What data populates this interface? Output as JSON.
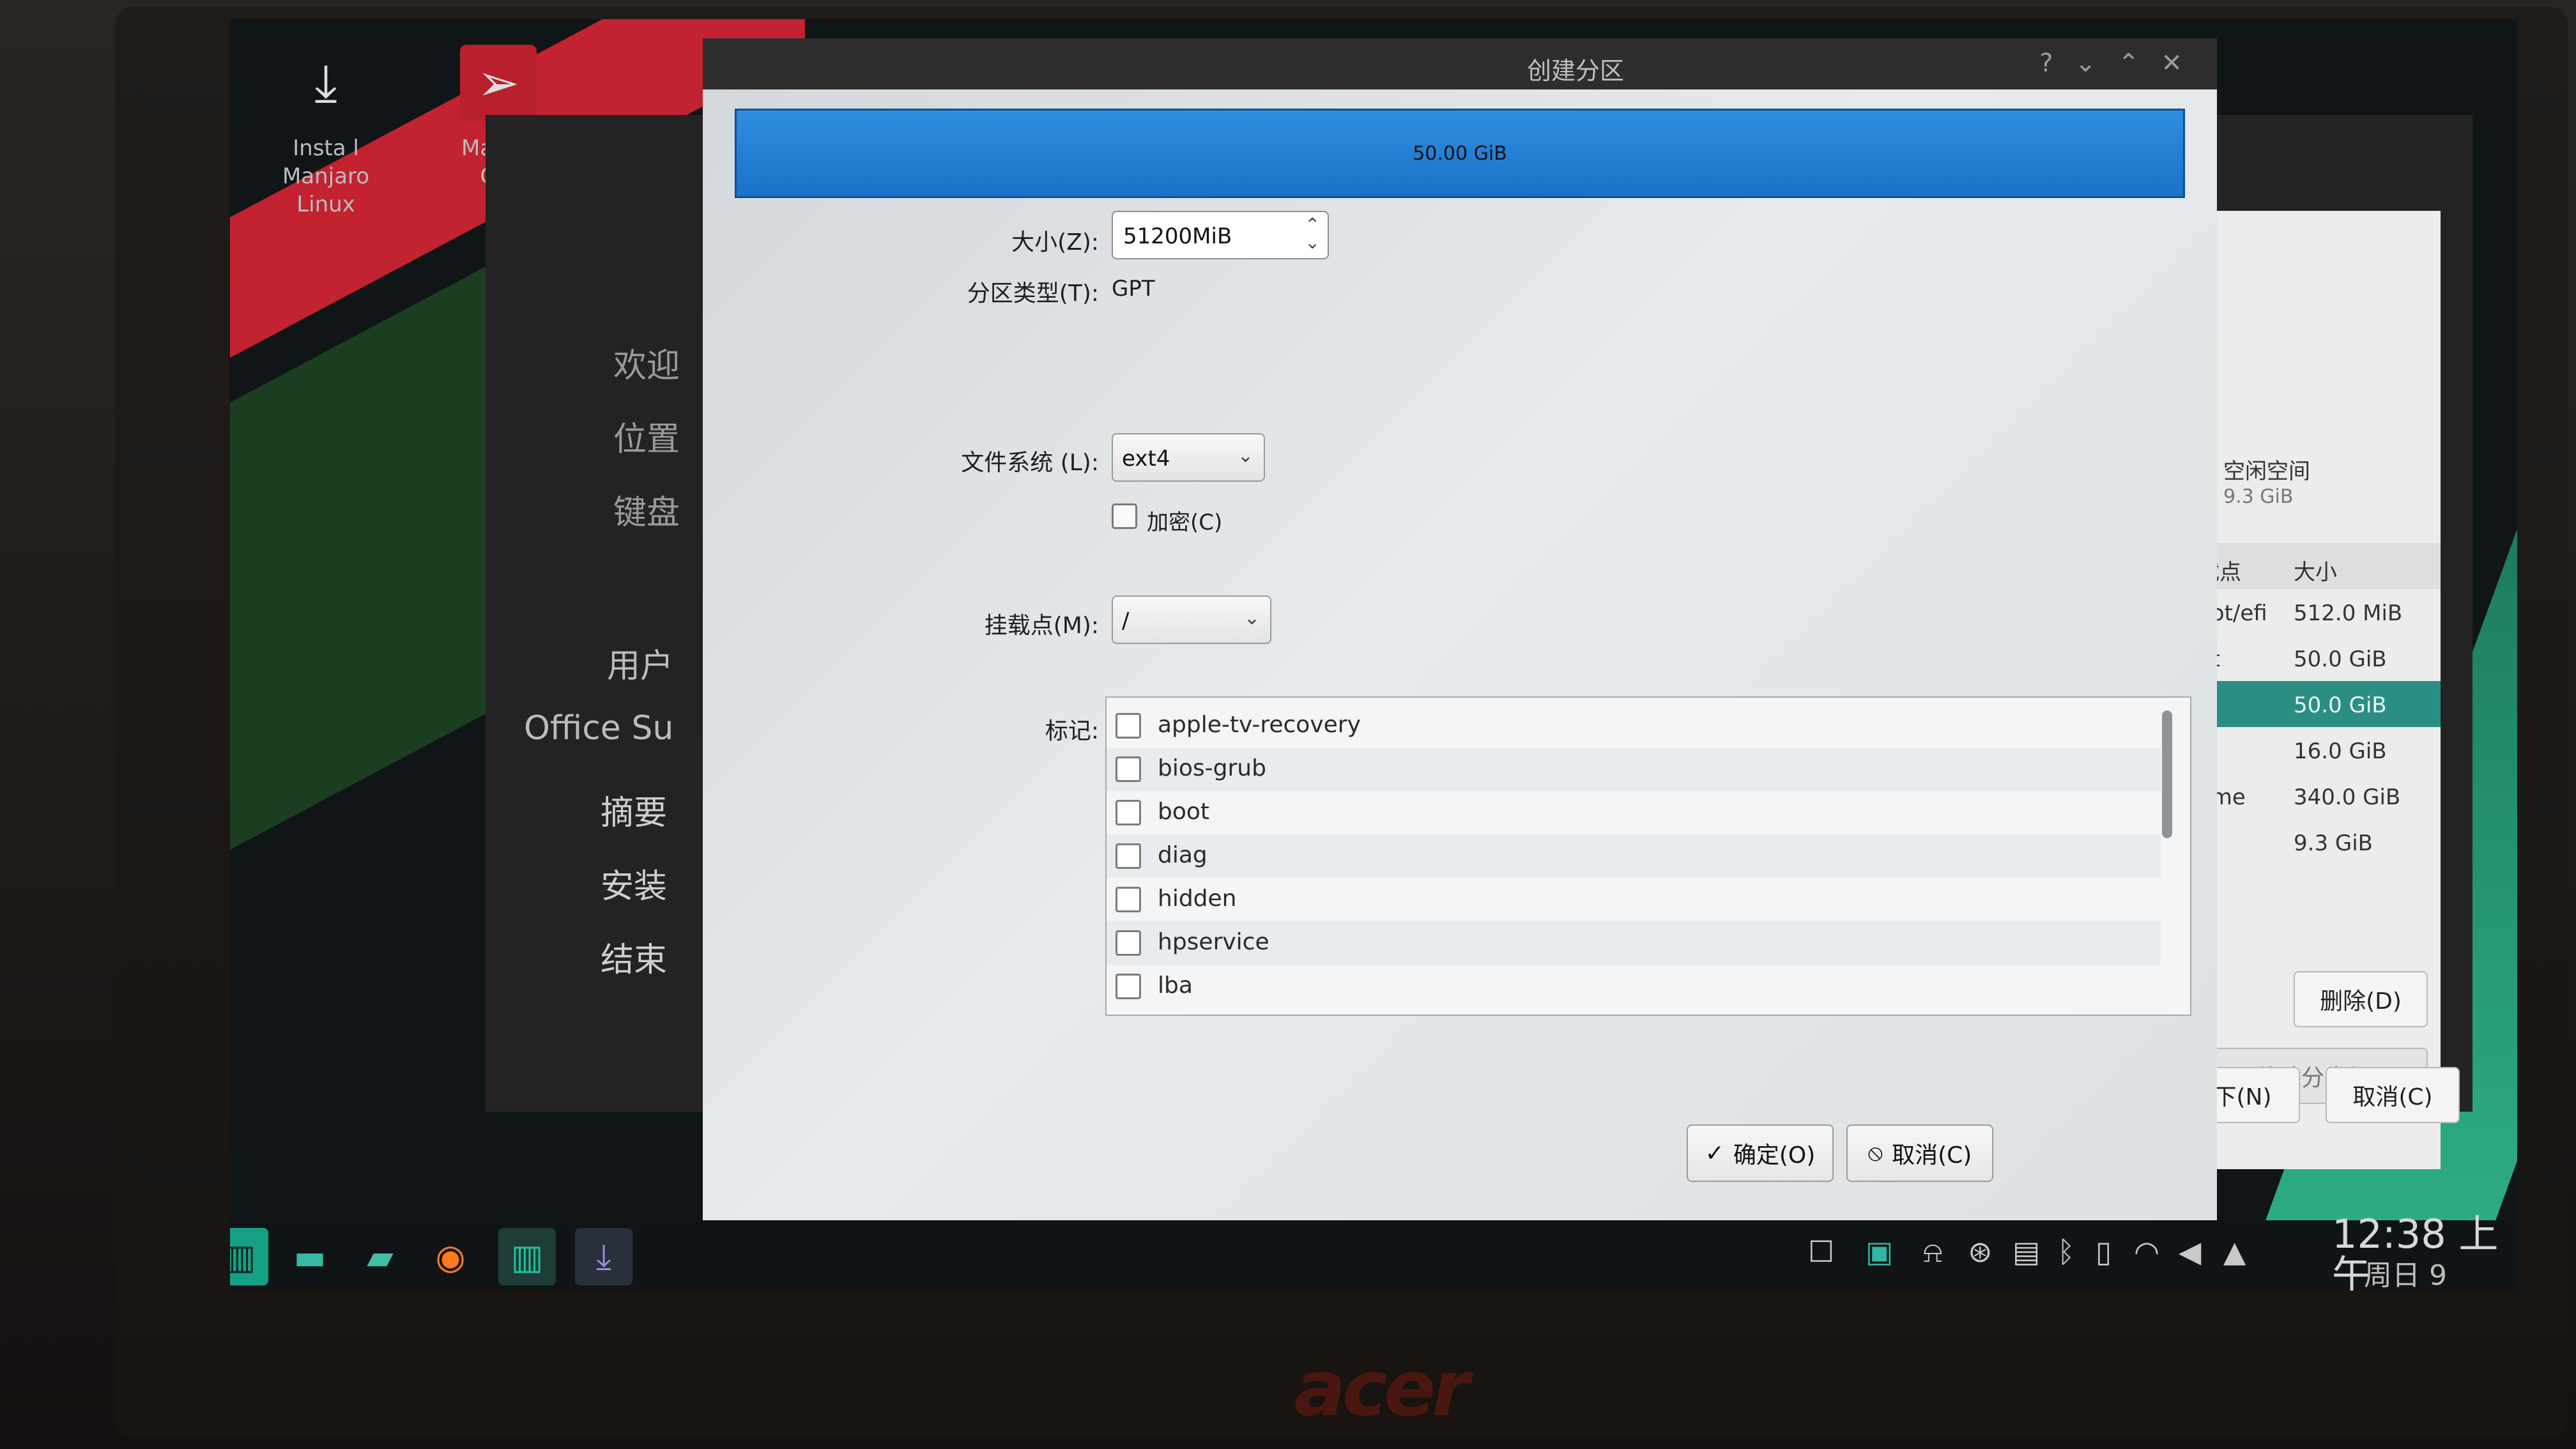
{
  "desktop": {
    "icons": [
      {
        "label_line1": "Insta l Manjaro",
        "label_line2": "Linux"
      },
      {
        "label_line1": "Manjar",
        "label_line2": "Gui"
      }
    ]
  },
  "installer": {
    "sidebar": [
      "欢迎",
      "位置",
      "键盘",
      "用户",
      "Office Su",
      "摘要",
      "安装",
      "结束"
    ],
    "right_panel": {
      "free_space_label": "空闲空间",
      "free_space_size": "9.3 GiB",
      "col_mount": "载点",
      "col_size": "大小",
      "rows": [
        {
          "mount": "oot/efi",
          "size": "512.0 MiB"
        },
        {
          "mount": "pt",
          "size": "50.0 GiB"
        },
        {
          "mount": "",
          "size": "50.0 GiB"
        },
        {
          "mount": "",
          "size": "16.0 GiB"
        },
        {
          "mount": "ome",
          "size": "340.0 GiB"
        },
        {
          "mount": "",
          "size": "9.3 GiB"
        }
      ],
      "delete_button": "删除(D)",
      "remove_vg_button": "移除分卷组",
      "next_partial": "下(N)",
      "cancel_button": "取消(C)"
    }
  },
  "dialog": {
    "title": "创建分区",
    "size_bar_text": "50.00 GiB",
    "size_label": "大小(Z):",
    "size_value": "51200MiB",
    "partition_type_label": "分区类型(T):",
    "partition_type_value": "GPT",
    "filesystem_label": "文件系统 (L):",
    "filesystem_value": "ext4",
    "encrypt_label": "加密(C)",
    "mount_label": "挂载点(M):",
    "mount_value": "/",
    "flags_label": "标记:",
    "flags": [
      "apple-tv-recovery",
      "bios-grub",
      "boot",
      "diag",
      "hidden",
      "hpservice",
      "lba"
    ],
    "ok_button": "确定(O)",
    "cancel_button": "取消(C)"
  },
  "taskbar": {
    "time": "12:38 上午",
    "date": "周日 9"
  },
  "monitor_brand": "acer"
}
